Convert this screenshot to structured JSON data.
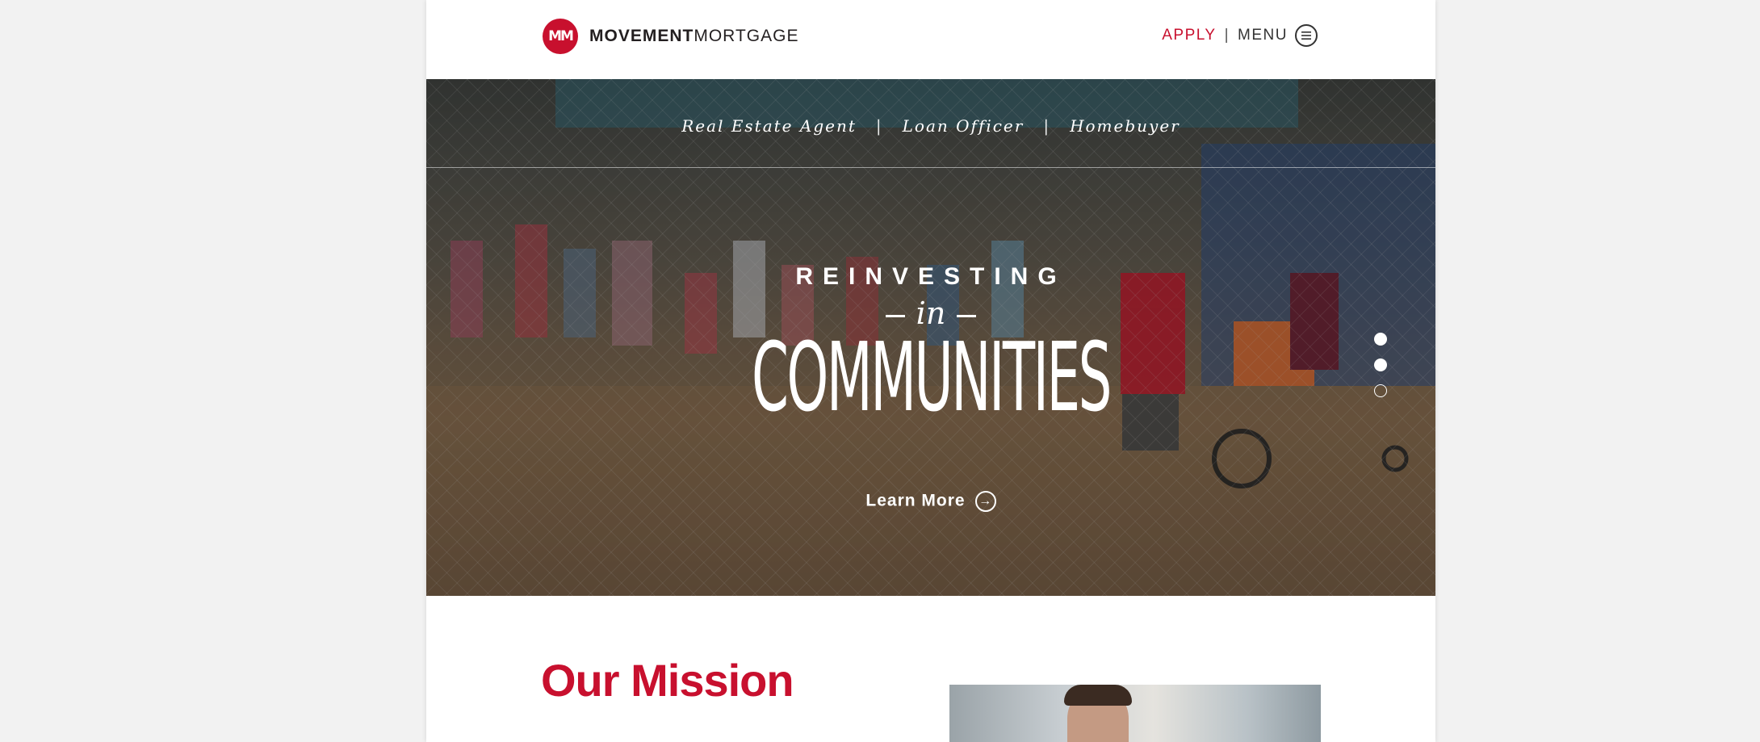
{
  "header": {
    "logo_mark": "MM",
    "brand_bold": "MOVEMENT",
    "brand_light": "MORTGAGE",
    "apply_label": "APPLY",
    "separator": "|",
    "menu_label": "MENU"
  },
  "hero": {
    "subnav": [
      "Real Estate Agent",
      "Loan Officer",
      "Homebuyer"
    ],
    "headline_top": "REINVESTING",
    "headline_mid": "in",
    "headline_main": "COMMUNITIES",
    "cta_label": "Learn More",
    "slides_total": 3,
    "slide_dots": [
      "filled",
      "filled",
      "empty"
    ]
  },
  "mission": {
    "title": "Our Mission"
  },
  "colors": {
    "brand_red": "#c8102e",
    "page_bg": "#f2f2f2"
  },
  "icons": [
    "logo-mm-icon",
    "menu-hamburger-icon",
    "arrow-right-circle-icon"
  ]
}
